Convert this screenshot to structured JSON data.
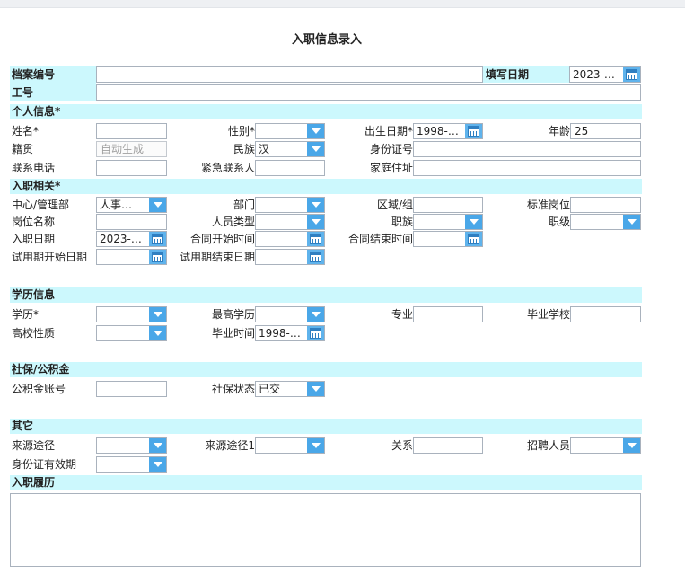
{
  "page_title": "入职信息录入",
  "top": {
    "archive_no_label": "档案编号",
    "fill_date_label": "填写日期",
    "fill_date_value": "2023-…",
    "job_no_label": "工号"
  },
  "personal": {
    "section": "个人信息*",
    "name_label": "姓名*",
    "gender_label": "性别*",
    "birth_label": "出生日期*",
    "birth_value": "1998-…",
    "age_label": "年龄",
    "age_value": "25",
    "native_label": "籍贯",
    "native_placeholder": "自动生成",
    "ethnic_label": "民族",
    "ethnic_value": "汉",
    "idcard_label": "身份证号",
    "phone_label": "联系电话",
    "emergency_label": "紧急联系人",
    "address_label": "家庭住址"
  },
  "entry": {
    "section": "入职相关*",
    "center_label": "中心/管理部",
    "center_value": "人事…",
    "dept_label": "部门",
    "region_label": "区域/组",
    "std_post_label": "标准岗位",
    "post_name_label": "岗位名称",
    "staff_type_label": "人员类型",
    "job_family_label": "职族",
    "job_level_label": "职级",
    "join_date_label": "入职日期",
    "join_date_value": "2023-…",
    "contract_start_label": "合同开始时间",
    "contract_end_label": "合同结束时间",
    "probation_start_label": "试用期开始日期",
    "probation_end_label": "试用期结束日期"
  },
  "education": {
    "section": "学历信息",
    "degree_label": "学历*",
    "highest_label": "最高学历",
    "major_label": "专业",
    "school_label": "毕业学校",
    "school_type_label": "高校性质",
    "grad_time_label": "毕业时间",
    "grad_time_value": "1998-…"
  },
  "insurance": {
    "section": "社保/公积金",
    "fund_label": "公积金账号",
    "social_status_label": "社保状态",
    "social_status_value": "已交"
  },
  "other": {
    "section": "其它",
    "source_label": "来源途径",
    "source1_label": "来源途径1",
    "relation_label": "关系",
    "recruiter_label": "招聘人员",
    "id_valid_label": "身份证有效期"
  },
  "history": {
    "section": "入职履历"
  },
  "colors": {
    "section_band": "#ccf8fd",
    "dropdown_button": "#4aa7e8",
    "calendar_button": "#5fb3ec"
  }
}
